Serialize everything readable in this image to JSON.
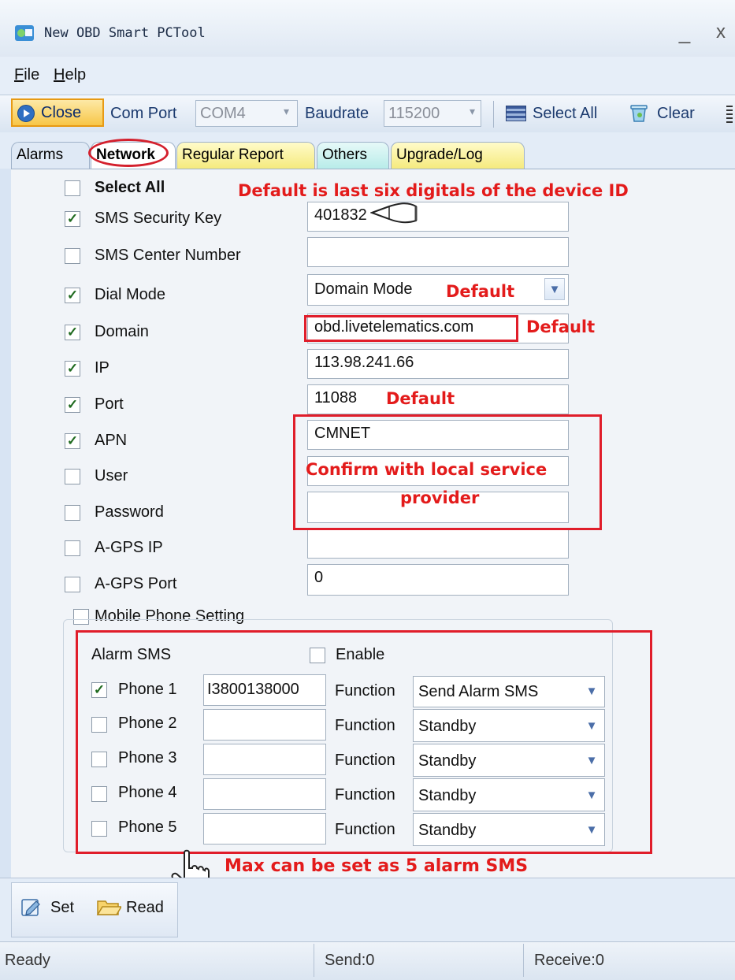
{
  "window": {
    "title": "New OBD Smart PCTool"
  },
  "menu": [
    {
      "label": "File",
      "underline": "F",
      "rest": "ile"
    },
    {
      "label": "Help",
      "underline": "H",
      "rest": "elp"
    }
  ],
  "toolbar": {
    "close_label": "Close",
    "com_port_label": "Com Port",
    "com_port_value": "COM4",
    "baudrate_label": "Baudrate",
    "baudrate_value": "115200",
    "select_all_label": "Select All",
    "clear_label": "Clear"
  },
  "tabs": [
    "Alarms",
    "Network",
    "Regular Report",
    "Others",
    "Upgrade/Log"
  ],
  "active_tab": "Network",
  "network": {
    "select_all": {
      "label": "Select All",
      "checked": false
    },
    "fields": [
      {
        "label": "SMS Security Key",
        "checked": true,
        "value": "401832"
      },
      {
        "label": "SMS Center Number",
        "checked": false,
        "value": ""
      },
      {
        "label": "Dial Mode",
        "checked": true,
        "value": "Domain Mode"
      },
      {
        "label": "Domain",
        "checked": true,
        "value": "obd.livetelematics.com"
      },
      {
        "label": "IP",
        "checked": true,
        "value": "113.98.241.66"
      },
      {
        "label": "Port",
        "checked": true,
        "value": "11088"
      },
      {
        "label": "APN",
        "checked": true,
        "value": "CMNET"
      },
      {
        "label": "User",
        "checked": false,
        "value": ""
      },
      {
        "label": "Password",
        "checked": false,
        "value": ""
      },
      {
        "label": "A-GPS IP",
        "checked": false,
        "value": ""
      },
      {
        "label": "A-GPS Port",
        "checked": false,
        "value": "0"
      }
    ],
    "mobile_phone_setting": {
      "label": "Mobile Phone Setting",
      "checked": false
    }
  },
  "alarm_sms": {
    "label": "Alarm SMS",
    "enable_label": "Enable",
    "enable_checked": false,
    "function_label": "Function",
    "phones": [
      {
        "label": "Phone 1",
        "checked": true,
        "number": "I3800138000",
        "function": "Send Alarm SMS"
      },
      {
        "label": "Phone 2",
        "checked": false,
        "number": "",
        "function": "Standby"
      },
      {
        "label": "Phone 3",
        "checked": false,
        "number": "",
        "function": "Standby"
      },
      {
        "label": "Phone 4",
        "checked": false,
        "number": "",
        "function": "Standby"
      },
      {
        "label": "Phone 5",
        "checked": false,
        "number": "",
        "function": "Standby"
      }
    ]
  },
  "annotations": {
    "device_id_note": "Default is last six digitals of the device ID",
    "dial_mode_default": "Default",
    "domain_default": "Default",
    "port_default": "Default",
    "apn_note": "Confirm with local service provider",
    "apn_note_line1": "Confirm with local service",
    "apn_note_line2": "provider",
    "alarm_note": "Max can be set as 5 alarm SMS",
    "annotation_color": "#e31b1b"
  },
  "bottom_toolbar": {
    "set_label": "Set",
    "read_label": "Read"
  },
  "status": {
    "ready": "Ready",
    "send": "Send:0",
    "receive": "Receive:0"
  },
  "colors": {
    "accent": "#f7c648",
    "tab_active": "#ffffff",
    "annotation": "#e01d2a"
  }
}
